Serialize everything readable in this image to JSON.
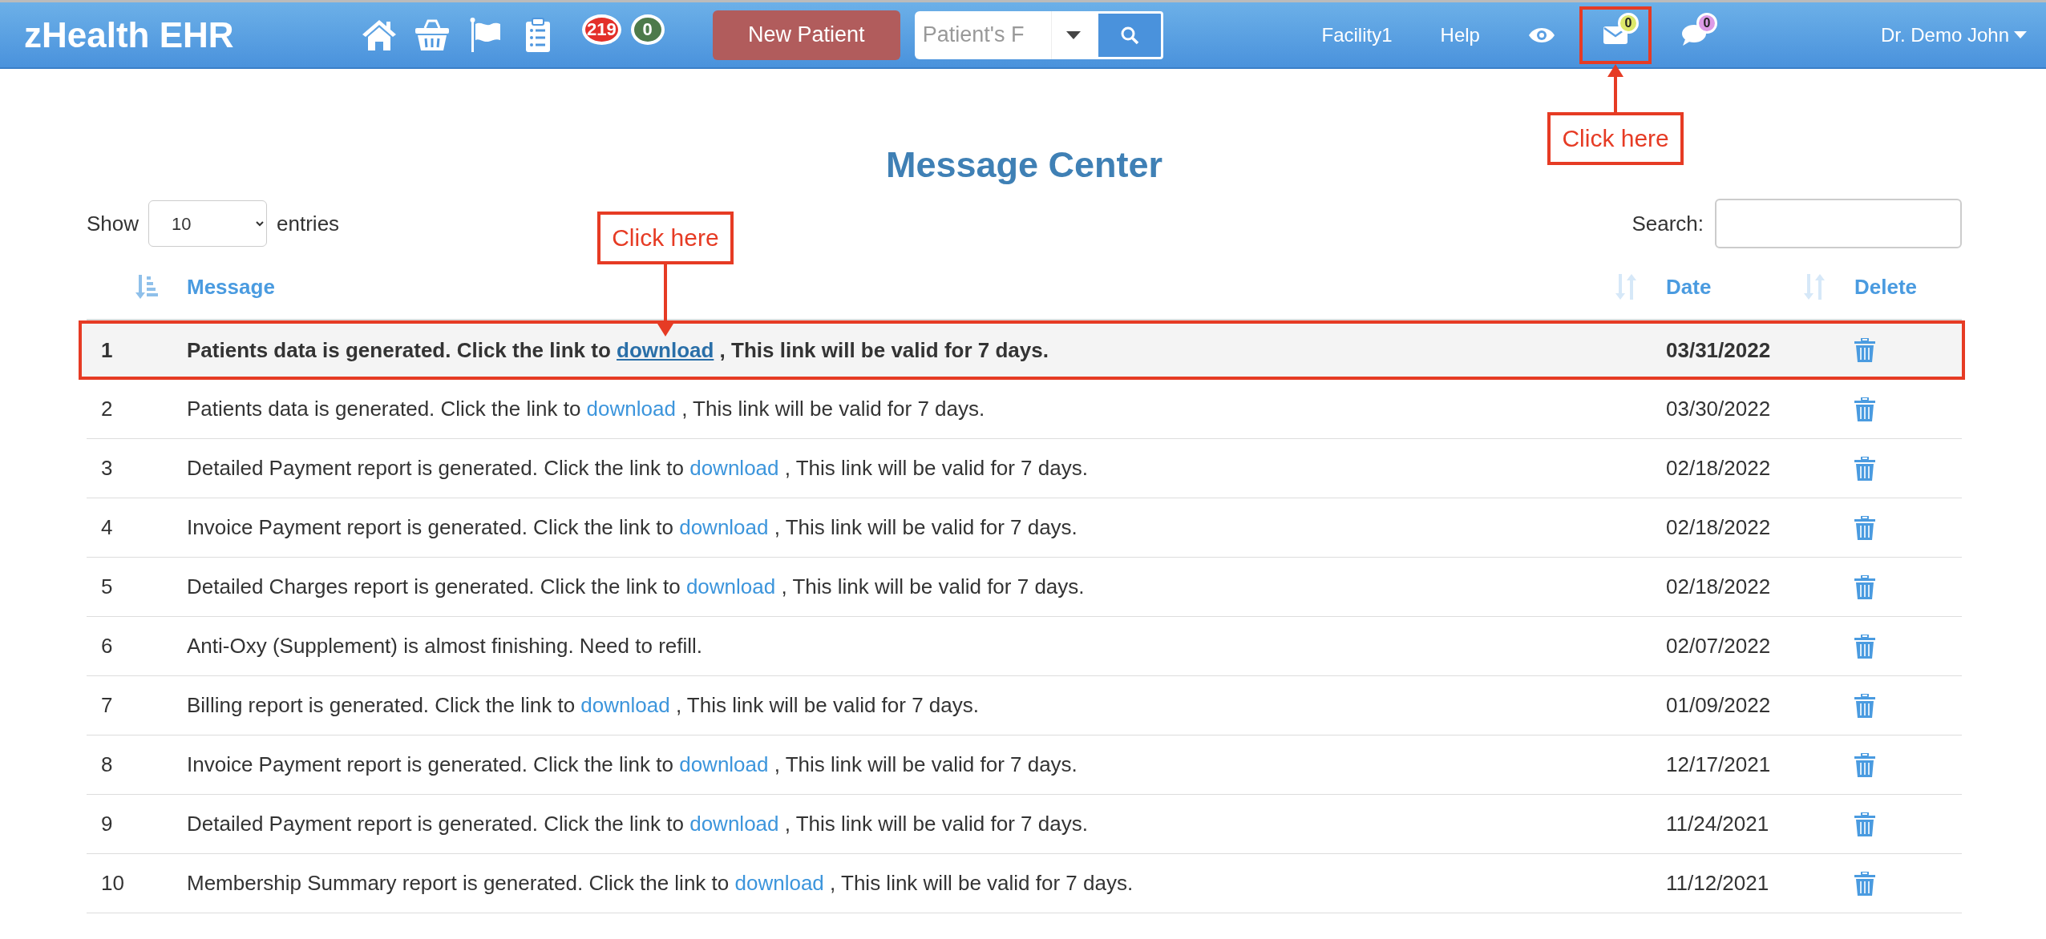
{
  "header": {
    "logo": "zHealth EHR",
    "nav_icons": [
      {
        "kind": "home"
      },
      {
        "kind": "basket"
      },
      {
        "kind": "flag"
      },
      {
        "kind": "clipboard"
      }
    ],
    "badges": [
      {
        "count": "219",
        "color": "#e3302a"
      },
      {
        "count": "0",
        "color": "#4d7a4b"
      }
    ],
    "new_patient_button": "New Patient",
    "patient_search": {
      "placeholder": "Patient's F"
    },
    "facility": "Facility1",
    "help": "Help",
    "messages": {
      "count": "0",
      "color": "#dce86a",
      "outlined": true,
      "callout": "Click here"
    },
    "chat": {
      "count": "0",
      "color": "#dc9ae6"
    },
    "user": "Dr. Demo John"
  },
  "title": "Message Center",
  "length_control": {
    "prefix": "Show",
    "value": "10",
    "suffix": "entries"
  },
  "search": {
    "label": "Search:"
  },
  "table": {
    "columns": [
      {
        "sortable": true,
        "sorted": true
      },
      {
        "label": "Message",
        "sortable": true,
        "sorted": false
      },
      {
        "label": "Date",
        "sortable": true,
        "sorted": false
      },
      {
        "label": "Delete"
      }
    ],
    "rows": [
      {
        "number": "1",
        "text": "Patients data is generated. Click the link to ",
        "link": "download",
        "after": " , This link will be valid for 7 days.",
        "date": "03/31/2022",
        "unread": true,
        "outlined": true,
        "callout": "Click here"
      },
      {
        "number": "2",
        "text": "Patients data is generated. Click the link to ",
        "link": "download",
        "after": " , This link will be valid for 7 days.",
        "date": "03/30/2022",
        "unread": false,
        "outlined": false
      },
      {
        "number": "3",
        "text": "Detailed Payment report is generated. Click the link to ",
        "link": "download",
        "after": " , This link will be valid for 7 days.",
        "date": "02/18/2022",
        "unread": false,
        "outlined": false
      },
      {
        "number": "4",
        "text": "Invoice Payment report is generated. Click the link to ",
        "link": "download",
        "after": " , This link will be valid for 7 days.",
        "date": "02/18/2022",
        "unread": false,
        "outlined": false
      },
      {
        "number": "5",
        "text": "Detailed Charges report is generated. Click the link to ",
        "link": "download",
        "after": " , This link will be valid for 7 days.",
        "date": "02/18/2022",
        "unread": false,
        "outlined": false
      },
      {
        "number": "6",
        "text": "Anti-Oxy (Supplement) is almost finishing. Need to refill.",
        "date": "02/07/2022",
        "unread": false,
        "outlined": false
      },
      {
        "number": "7",
        "text": "Billing report is generated. Click the link to ",
        "link": "download",
        "after": " , This link will be valid for 7 days.",
        "date": "01/09/2022",
        "unread": false,
        "outlined": false
      },
      {
        "number": "8",
        "text": "Invoice Payment report is generated. Click the link to ",
        "link": "download",
        "after": " , This link will be valid for 7 days.",
        "date": "12/17/2021",
        "unread": false,
        "outlined": false
      },
      {
        "number": "9",
        "text": "Detailed Payment report is generated. Click the link to ",
        "link": "download",
        "after": " , This link will be valid for 7 days.",
        "date": "11/24/2021",
        "unread": false,
        "outlined": false
      },
      {
        "number": "10",
        "text": "Membership Summary report is generated. Click the link to ",
        "link": "download",
        "after": " , This link will be valid for 7 days.",
        "date": "11/12/2021",
        "unread": false,
        "outlined": false
      }
    ]
  }
}
